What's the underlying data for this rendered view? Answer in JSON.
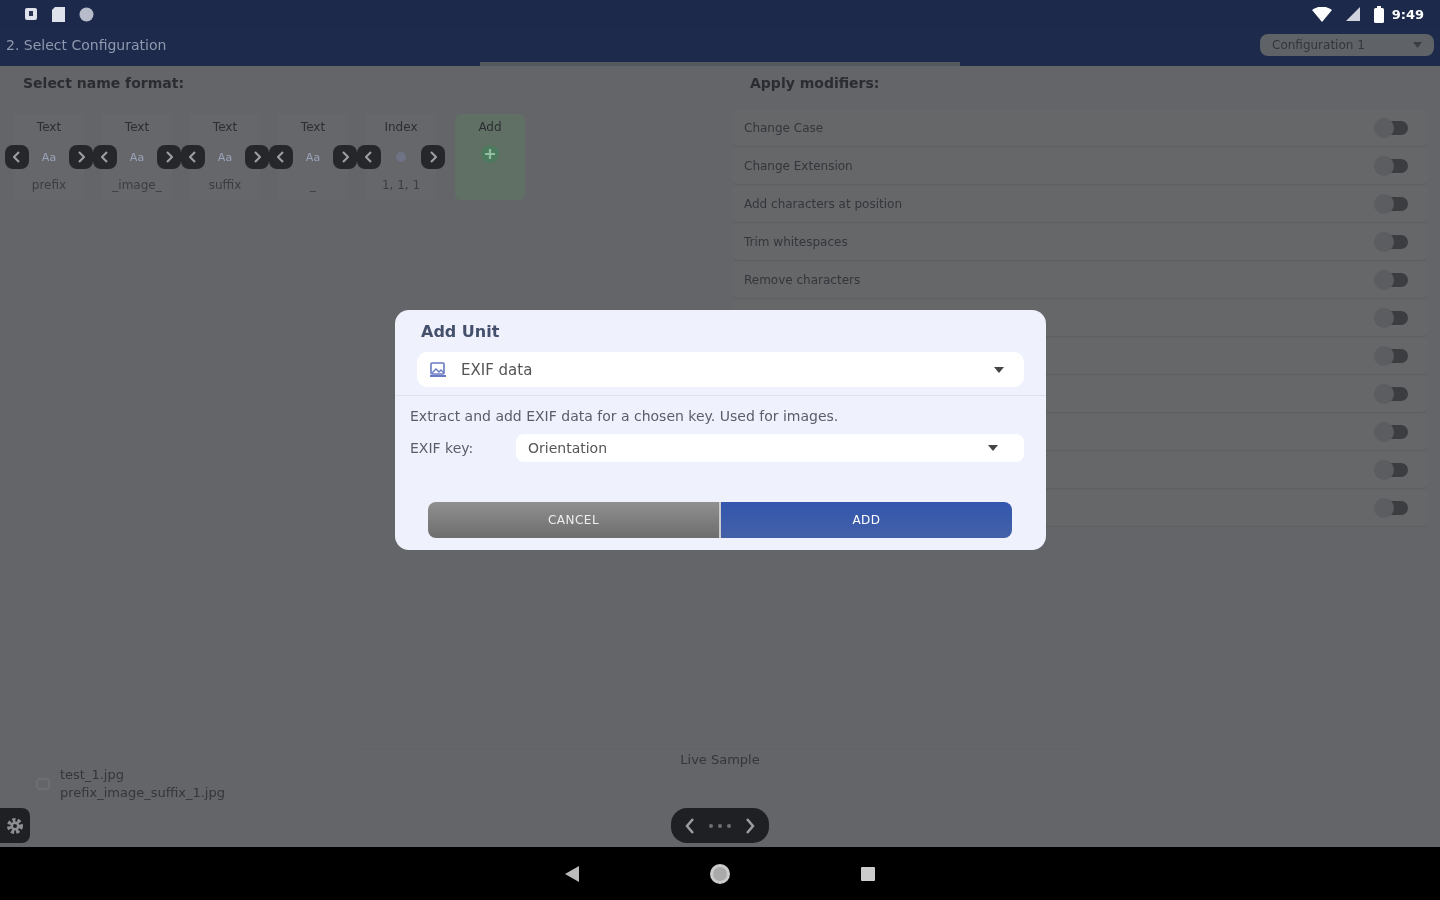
{
  "status_bar": {
    "time": "9:49"
  },
  "app_bar": {
    "title": "2. Select Configuration",
    "config_dropdown": "Configuration 1",
    "progress": {
      "level": 0.5
    }
  },
  "name_format": {
    "heading": "Select name format:",
    "units": [
      {
        "kind": "text",
        "header": "Text",
        "preview": "Aa",
        "label": "prefix"
      },
      {
        "kind": "text",
        "header": "Text",
        "preview": "Aa",
        "label": "_image_"
      },
      {
        "kind": "text",
        "header": "Text",
        "preview": "Aa",
        "label": "suffix"
      },
      {
        "kind": "text",
        "header": "Text",
        "preview": "Aa",
        "label": "_"
      },
      {
        "kind": "index",
        "header": "Index",
        "label": "1, 1, 1"
      }
    ],
    "add_label": "Add"
  },
  "modifiers": {
    "heading": "Apply modifiers:",
    "items": [
      {
        "label": "Change Case",
        "on": false
      },
      {
        "label": "Change Extension",
        "on": false
      },
      {
        "label": "Add characters at position",
        "on": false
      },
      {
        "label": "Trim whitespaces",
        "on": false
      },
      {
        "label": "Remove characters",
        "on": false
      },
      {
        "on": false
      },
      {
        "on": false
      },
      {
        "on": false
      },
      {
        "on": false
      },
      {
        "on": false
      },
      {
        "on": false
      }
    ]
  },
  "live_sample": {
    "heading": "Live Sample",
    "original": "test_1.jpg",
    "result": "prefix_image_suffix_1.jpg"
  },
  "dialog": {
    "title": "Add Unit",
    "unit_type": "EXIF data",
    "description": "Extract and add EXIF data for a chosen key. Used for images.",
    "key_label": "EXIF key:",
    "key_value": "Orientation",
    "buttons": [
      {
        "kind": "cancel",
        "label": "CANCEL"
      },
      {
        "kind": "confirm",
        "label": "ADD"
      }
    ]
  }
}
